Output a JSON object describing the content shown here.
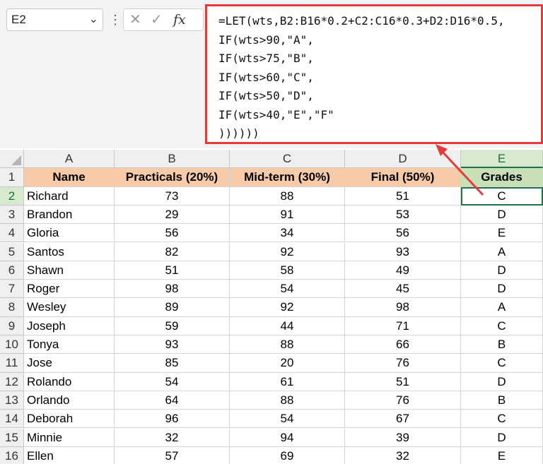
{
  "name_box": {
    "value": "E2",
    "chevron": "chevron-down-icon"
  },
  "formula_bar": {
    "icons": [
      "cancel-icon",
      "enter-icon",
      "function-icon"
    ],
    "lines": [
      "=LET(wts,B2:B16*0.2+C2:C16*0.3+D2:D16*0.5,",
      "IF(wts>90,\"A\",",
      "IF(wts>75,\"B\",",
      "IF(wts>60,\"C\",",
      "IF(wts>50,\"D\",",
      "IF(wts>40,\"E\",\"F\"",
      "))))))"
    ]
  },
  "colors": {
    "header_fill": "#f7caa8",
    "grades_fill": "#c9dfb8",
    "highlight_border": "#e53b3b",
    "selection": "#217346"
  },
  "sheet": {
    "column_letters": [
      "A",
      "B",
      "C",
      "D",
      "E"
    ],
    "headers": [
      "Name",
      "Practicals (20%)",
      "Mid-term (30%)",
      "Final (50%)",
      "Grades"
    ],
    "rows": [
      [
        "Richard",
        "73",
        "88",
        "51",
        "C"
      ],
      [
        "Brandon",
        "29",
        "91",
        "53",
        "D"
      ],
      [
        "Gloria",
        "56",
        "34",
        "56",
        "E"
      ],
      [
        "Santos",
        "82",
        "92",
        "93",
        "A"
      ],
      [
        "Shawn",
        "51",
        "58",
        "49",
        "D"
      ],
      [
        "Roger",
        "98",
        "54",
        "45",
        "D"
      ],
      [
        "Wesley",
        "89",
        "92",
        "98",
        "A"
      ],
      [
        "Joseph",
        "59",
        "44",
        "71",
        "C"
      ],
      [
        "Tonya",
        "93",
        "88",
        "66",
        "B"
      ],
      [
        "Jose",
        "85",
        "20",
        "76",
        "C"
      ],
      [
        "Rolando",
        "54",
        "61",
        "51",
        "D"
      ],
      [
        "Orlando",
        "64",
        "88",
        "76",
        "B"
      ],
      [
        "Deborah",
        "96",
        "54",
        "67",
        "C"
      ],
      [
        "Minnie",
        "32",
        "94",
        "39",
        "D"
      ],
      [
        "Ellen",
        "57",
        "69",
        "32",
        "E"
      ]
    ]
  }
}
